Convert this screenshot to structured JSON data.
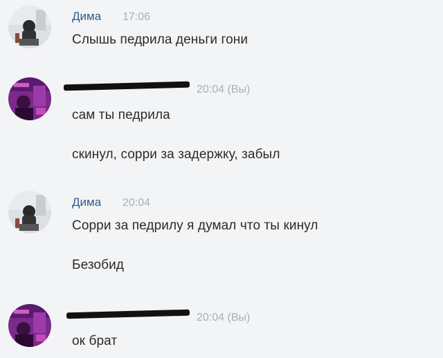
{
  "messages": [
    {
      "sender": "Дима",
      "time": "17:06",
      "lines": [
        "Слышь педрила деньги гони"
      ],
      "avatar_icon": "user-photo"
    },
    {
      "sender": "",
      "sender_redacted": true,
      "time": "20:04 (Вы)",
      "lines": [
        "сам ты педрила",
        "скинул, сорри за задержку, забыл"
      ],
      "avatar_icon": "purple-user-photo"
    },
    {
      "sender": "Дима",
      "time": "20:04",
      "lines": [
        "Сорри за педрилу я думал что ты кинул",
        "Безобид"
      ],
      "avatar_icon": "user-photo"
    },
    {
      "sender": "",
      "sender_redacted": true,
      "time": "20:04 (Вы)",
      "lines": [
        "ок брат"
      ],
      "avatar_icon": "purple-user-photo"
    }
  ],
  "colors": {
    "background": "#f3f4f6",
    "sender_name": "#2f5a8a",
    "timestamp": "#a9aeb6",
    "message_text": "#2b2b2b",
    "redaction": "#111111"
  }
}
